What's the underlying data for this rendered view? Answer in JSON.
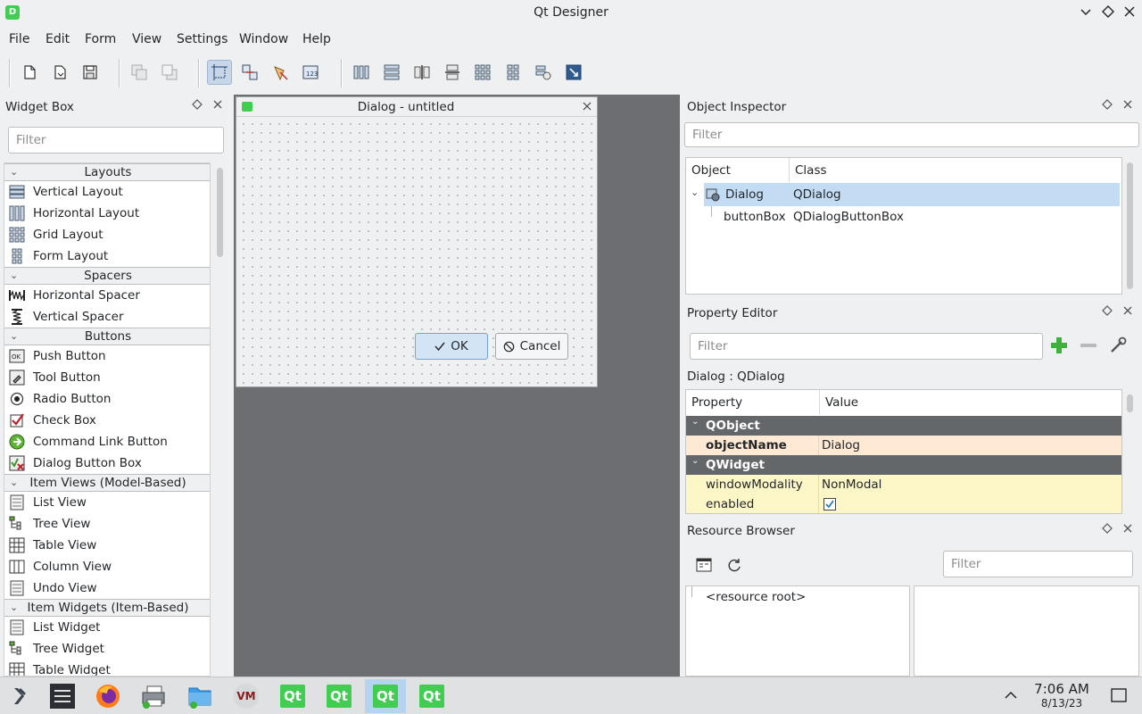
{
  "window": {
    "title": "Qt Designer",
    "app_icon_letter": "D",
    "controls": [
      "minimize",
      "maximize",
      "close"
    ]
  },
  "menu": [
    "File",
    "Edit",
    "Form",
    "View",
    "Settings",
    "Window",
    "Help"
  ],
  "toolbar": {
    "buttons": [
      "new-form",
      "open-form",
      "save-form",
      "bring-to-front",
      "send-to-back",
      "edit-widgets",
      "edit-signals-slots",
      "edit-buddies",
      "edit-tab-order",
      "lay-out-horizontally",
      "lay-out-vertically",
      "lay-out-horizontally-in-splitter",
      "lay-out-vertically-in-splitter",
      "lay-out-in-grid",
      "lay-out-in-form",
      "break-layout",
      "adjust-size"
    ],
    "active": "edit-widgets"
  },
  "widget_box": {
    "title": "Widget Box",
    "filter_placeholder": "Filter",
    "categories": [
      {
        "label": "Layouts",
        "items": [
          {
            "label": "Vertical Layout",
            "icon": "vertical-layout-icon"
          },
          {
            "label": "Horizontal Layout",
            "icon": "horizontal-layout-icon"
          },
          {
            "label": "Grid Layout",
            "icon": "grid-layout-icon"
          },
          {
            "label": "Form Layout",
            "icon": "form-layout-icon"
          }
        ]
      },
      {
        "label": "Spacers",
        "items": [
          {
            "label": "Horizontal Spacer",
            "icon": "horizontal-spacer-icon"
          },
          {
            "label": "Vertical Spacer",
            "icon": "vertical-spacer-icon"
          }
        ]
      },
      {
        "label": "Buttons",
        "items": [
          {
            "label": "Push Button",
            "icon": "push-button-icon"
          },
          {
            "label": "Tool Button",
            "icon": "tool-button-icon"
          },
          {
            "label": "Radio Button",
            "icon": "radio-button-icon"
          },
          {
            "label": "Check Box",
            "icon": "check-box-icon"
          },
          {
            "label": "Command Link Button",
            "icon": "command-link-icon"
          },
          {
            "label": "Dialog Button Box",
            "icon": "dialog-button-box-icon"
          }
        ]
      },
      {
        "label": "Item Views (Model-Based)",
        "items": [
          {
            "label": "List View",
            "icon": "list-view-icon"
          },
          {
            "label": "Tree View",
            "icon": "tree-view-icon"
          },
          {
            "label": "Table View",
            "icon": "table-view-icon"
          },
          {
            "label": "Column View",
            "icon": "column-view-icon"
          },
          {
            "label": "Undo View",
            "icon": "undo-view-icon"
          }
        ]
      },
      {
        "label": "Item Widgets (Item-Based)",
        "items": [
          {
            "label": "List Widget",
            "icon": "list-widget-icon"
          },
          {
            "label": "Tree Widget",
            "icon": "tree-widget-icon"
          },
          {
            "label": "Table Widget",
            "icon": "table-widget-icon"
          }
        ]
      }
    ]
  },
  "form": {
    "title": "Dialog - untitled",
    "ok_label": "OK",
    "cancel_label": "Cancel"
  },
  "object_inspector": {
    "title": "Object Inspector",
    "filter_placeholder": "Filter",
    "columns": [
      "Object",
      "Class"
    ],
    "rows": [
      {
        "object": "Dialog",
        "class": "QDialog",
        "selected": true
      },
      {
        "object": "buttonBox",
        "class": "QDialogButtonBox",
        "selected": false
      }
    ]
  },
  "property_editor": {
    "title": "Property Editor",
    "filter_placeholder": "Filter",
    "context": "Dialog : QDialog",
    "columns": [
      "Property",
      "Value"
    ],
    "rows": [
      {
        "type": "group",
        "name": "QObject"
      },
      {
        "type": "prop",
        "name": "objectName",
        "value": "Dialog",
        "bold": true,
        "color": "#fde9d4"
      },
      {
        "type": "group",
        "name": "QWidget"
      },
      {
        "type": "prop",
        "name": "windowModality",
        "value": "NonModal",
        "bold": false,
        "color": "#fdf7c7"
      },
      {
        "type": "prop",
        "name": "enabled",
        "value": "",
        "checked": true,
        "bold": false,
        "color": "#fdf7c7"
      }
    ]
  },
  "resource_browser": {
    "title": "Resource Browser",
    "filter_placeholder": "Filter",
    "root_label": "<resource root>"
  },
  "taskbar": {
    "items": [
      "app-launcher",
      "system-settings",
      "firefox",
      "printer",
      "file-manager",
      "vym",
      "qt-designer-1",
      "qt-designer-2",
      "qt-designer-3",
      "qt-designer-4"
    ],
    "active": "qt-designer-3",
    "time": "7:06 AM",
    "date": "8/13/23"
  },
  "colors": {
    "accent": "#3daee9",
    "selection": "#c4dcf3",
    "qt_green": "#41cd52",
    "mdi_background": "#6c6e71"
  }
}
